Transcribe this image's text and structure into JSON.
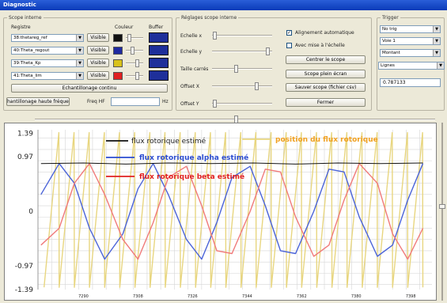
{
  "window": {
    "title": "Diagnostic"
  },
  "scope_interne": {
    "title": "Scope interne",
    "col_registre": "Registre",
    "col_couleur": "Couleur",
    "col_buffer": "Buffer",
    "rows": [
      {
        "register": "38:thetareg_ref",
        "visible": "Visible",
        "color": "#111111"
      },
      {
        "register": "40:Theta_regout",
        "visible": "Visible",
        "color": "#1f2aa0"
      },
      {
        "register": "39:Theta_Kp",
        "visible": "Visible",
        "color": "#d8c21a"
      },
      {
        "register": "41:Theta_lim",
        "visible": "Visible",
        "color": "#e02020"
      }
    ],
    "echantillonage_label": "Echantillonage continu",
    "haute_freq_label": "hantillonage haute fréquen",
    "freq_hf_label": "Freq HF",
    "freq_hf_value": "",
    "hz_label": "Hz"
  },
  "reglages": {
    "title": "Réglages scope interne",
    "echelle_x": "Echelle x",
    "echelle_y": "Echelle y",
    "taille_carres": "Taille carrés",
    "offset_x": "Offset X",
    "offset_y": "Offset Y",
    "alignement_label": "Alignement automatique",
    "alignement_checked": true,
    "avec_mise_label": "Avec mise à l'échelle",
    "avec_mise_checked": false,
    "centrer_label": "Centrer le scope",
    "plein_ecran_label": "Scope plein écran",
    "sauver_label": "Sauver scope (fichier csv)",
    "fermer_label": "Fermer"
  },
  "trigger": {
    "title": "Trigger",
    "mode": "No trig",
    "voie": "Voie 1",
    "front": "Montant",
    "affichage": "Lignes",
    "level_value": "0.787133"
  },
  "chart_data": {
    "type": "line",
    "y_ticks": [
      "1.39",
      "0.97",
      "0",
      "-0.97",
      "-1.39"
    ],
    "y_tick_values": [
      1.39,
      0.97,
      0,
      -0.97,
      -1.39
    ],
    "ylim": [
      -1.39,
      1.45
    ],
    "xlim": [
      7275,
      7405
    ],
    "x_ticks": [
      "7290",
      "7308",
      "7326",
      "7344",
      "7362",
      "7380",
      "7398"
    ],
    "x_tick_values": [
      7290,
      7308,
      7326,
      7344,
      7362,
      7380,
      7398
    ],
    "grid": true,
    "legend": [
      {
        "name": "flux rotorique estimé",
        "color": "#111111"
      },
      {
        "name": "position du flux rotorique",
        "color": "#e8d680"
      },
      {
        "name": "flux rotorique alpha estimé",
        "color": "#2a4bd0"
      },
      {
        "name": "flux rotorique beta estimé",
        "color": "#e02020"
      }
    ],
    "series": [
      {
        "name": "flux rotorique estimé",
        "color": "#111111",
        "x": [
          7276,
          7290,
          7304,
          7318,
          7332,
          7346,
          7360,
          7374,
          7388,
          7402
        ],
        "y": [
          0.85,
          0.86,
          0.84,
          0.86,
          0.85,
          0.86,
          0.84,
          0.86,
          0.85,
          0.86
        ]
      },
      {
        "name": "flux rotorique alpha estimé",
        "color": "#4a63d8",
        "x": [
          7276,
          7282,
          7287,
          7292,
          7297,
          7303,
          7308,
          7313,
          7318,
          7324,
          7329,
          7334,
          7339,
          7345,
          7350,
          7355,
          7360,
          7366,
          7371,
          7376,
          7381,
          7387,
          7392,
          7397,
          7402
        ],
        "y": [
          0.3,
          0.85,
          0.5,
          -0.3,
          -0.85,
          -0.4,
          0.4,
          0.85,
          0.3,
          -0.5,
          -0.85,
          -0.2,
          0.6,
          0.8,
          0.1,
          -0.7,
          -0.75,
          0.0,
          0.75,
          0.7,
          -0.1,
          -0.8,
          -0.6,
          0.2,
          0.85
        ]
      },
      {
        "name": "flux rotorique beta estimé",
        "color": "#f07a7a",
        "x": [
          7276,
          7282,
          7287,
          7292,
          7297,
          7303,
          7308,
          7313,
          7318,
          7324,
          7329,
          7334,
          7339,
          7345,
          7350,
          7355,
          7360,
          7366,
          7371,
          7376,
          7381,
          7387,
          7392,
          7397,
          7402
        ],
        "y": [
          -0.6,
          -0.3,
          0.5,
          0.85,
          0.3,
          -0.5,
          -0.85,
          -0.2,
          0.6,
          0.8,
          0.1,
          -0.7,
          -0.75,
          0.0,
          0.75,
          0.7,
          -0.1,
          -0.8,
          -0.6,
          0.2,
          0.85,
          0.5,
          -0.4,
          -0.85,
          -0.3
        ]
      },
      {
        "name": "position du flux rotorique",
        "color": "#e8d680",
        "x": [
          7277,
          7281.9,
          7282,
          7286.9,
          7287,
          7291.9,
          7292,
          7296.9,
          7297,
          7301.9,
          7302,
          7306.9,
          7307,
          7311.9,
          7312,
          7316.9,
          7317,
          7321.9,
          7322,
          7326.9,
          7327,
          7331.9,
          7332,
          7336.9,
          7337,
          7341.9,
          7342,
          7346.9,
          7347,
          7351.9,
          7352,
          7356.9,
          7357,
          7361.9,
          7362,
          7366.9,
          7367,
          7371.9,
          7372,
          7376.9,
          7377,
          7381.9,
          7382,
          7386.9,
          7387,
          7391.9,
          7392,
          7396.9,
          7397,
          7401.9,
          7402
        ],
        "y": [
          -1.35,
          1.4,
          -1.35,
          1.4,
          -1.35,
          1.4,
          -1.35,
          1.4,
          -1.35,
          1.4,
          -1.35,
          1.4,
          -1.35,
          1.4,
          -1.35,
          1.4,
          -1.35,
          1.4,
          -1.35,
          1.4,
          -1.35,
          1.4,
          -1.35,
          1.4,
          -1.35,
          1.4,
          -1.35,
          1.4,
          -1.35,
          1.4,
          -1.35,
          1.4,
          -1.35,
          1.4,
          -1.35,
          1.4,
          -1.35,
          1.4,
          -1.35,
          1.4,
          -1.35,
          1.4,
          -1.35,
          1.4,
          -1.35,
          1.4,
          -1.35,
          1.4,
          -1.35,
          1.4,
          -1.35
        ]
      }
    ]
  }
}
